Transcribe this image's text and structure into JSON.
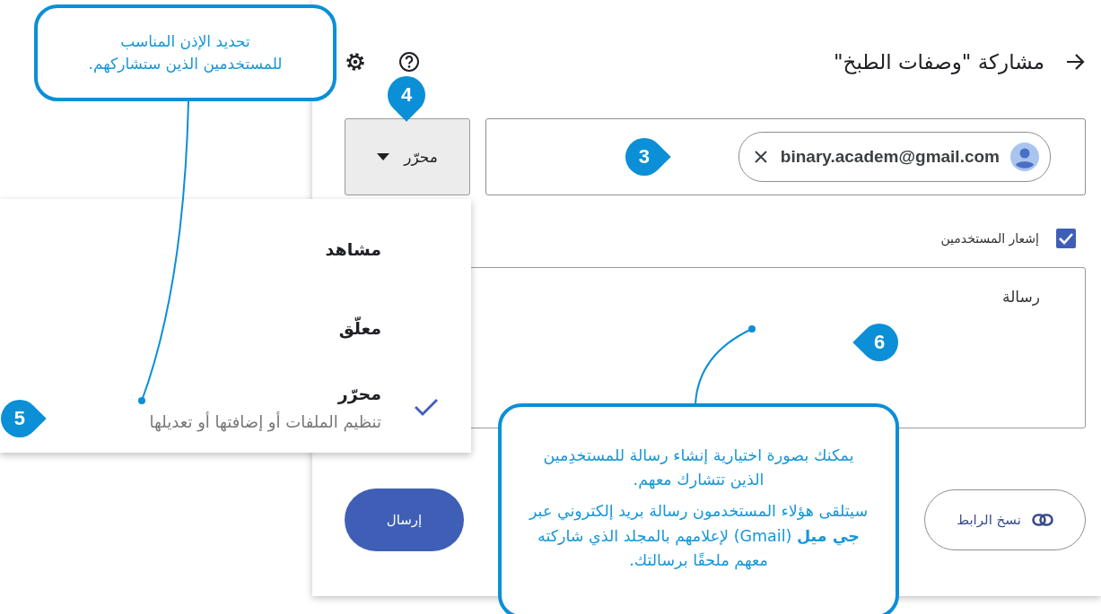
{
  "dialog": {
    "title": "مشاركة \"وصفات الطبخ\"",
    "role_button": {
      "label": "محرّر"
    },
    "recipient_chip": {
      "email": "binary.academ@gmail.com"
    },
    "notify": {
      "label": "إشعار المستخدمين",
      "checked": true
    },
    "message": {
      "placeholder": "رسالة"
    },
    "copy_link_button": "نسخ الرابط",
    "send_button": "إرسال"
  },
  "role_menu": [
    {
      "label": "مشاهد",
      "selected": false
    },
    {
      "label": "معلّق",
      "selected": false
    },
    {
      "label": "محرّر",
      "description": "تنظيم الملفات أو إضافتها أو تعديلها",
      "selected": true
    }
  ],
  "callouts": [
    {
      "paragraphs": [
        "تحديد الإذن المناسب للمستخدمين الذين ستشاركهم."
      ]
    },
    {
      "paragraphs": [
        "يمكنك بصورة اختيارية إنشاء رسالة للمستخدِمين الذين تتشارك معهم.",
        "سيتلقى هؤلاء المستخدمون رسالة بريد إلكتروني عبر **جي ميل** (Gmail) لإعلامهم بالمجلد الذي شاركته معهم ملحقًا برسالتك."
      ]
    }
  ],
  "step_markers": [
    "4",
    "3",
    "5",
    "6"
  ]
}
